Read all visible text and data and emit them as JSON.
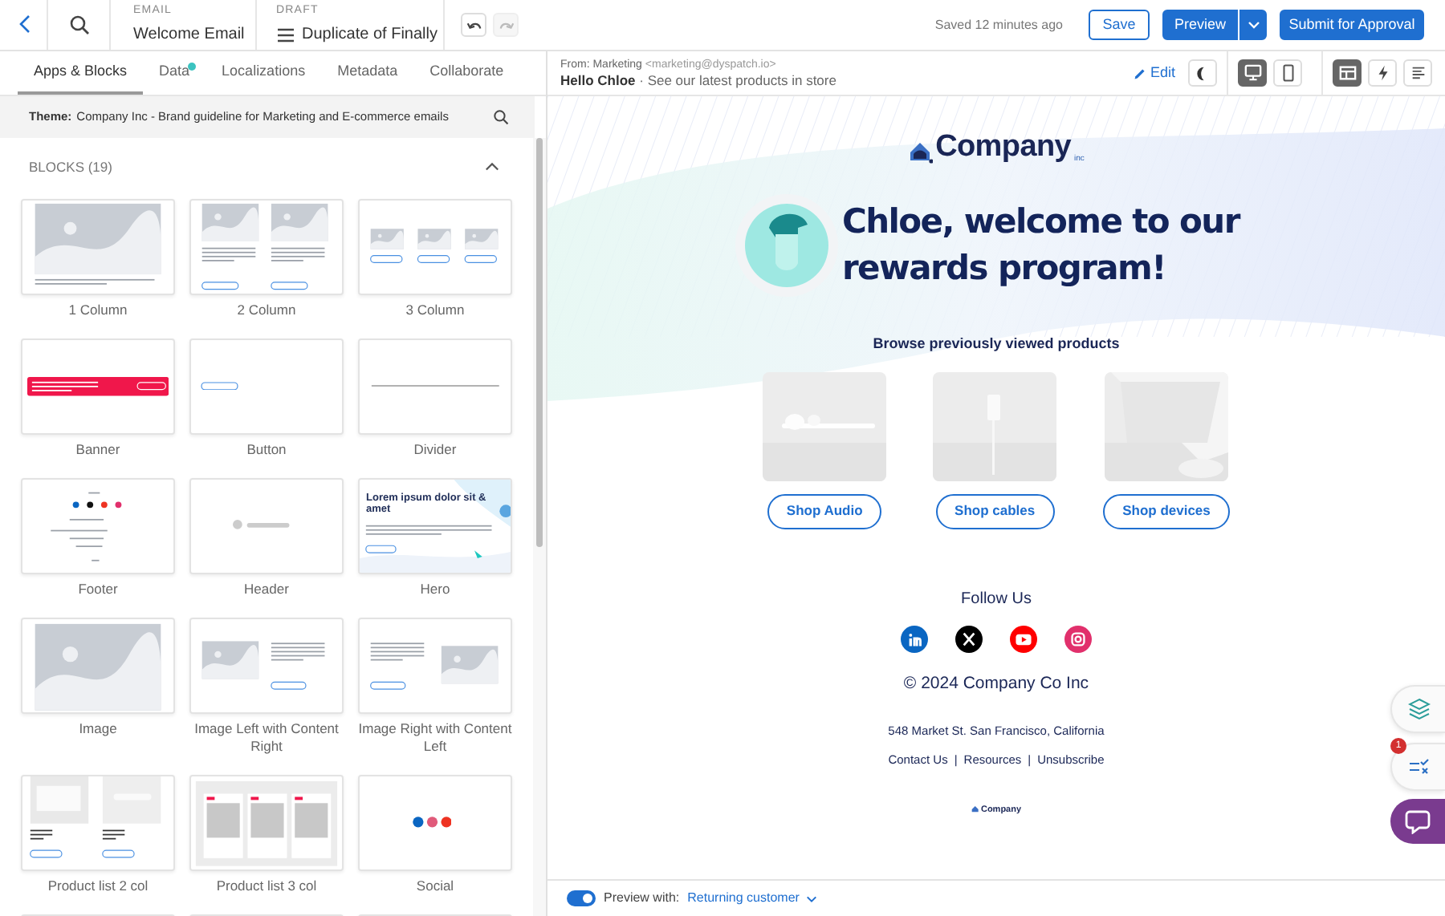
{
  "topbar": {
    "email_label": "EMAIL",
    "email_name": "Welcome Email",
    "draft_label": "DRAFT",
    "draft_name": "Duplicate of Finally",
    "undo_disabled": false,
    "redo_disabled": true,
    "saved": "Saved 12 minutes ago",
    "buttons": [
      {
        "label": "Save",
        "kind": "outline"
      },
      {
        "label": "Preview",
        "kind": "split"
      },
      {
        "label": "Submit for Approval",
        "kind": "primary"
      }
    ]
  },
  "tabs": [
    {
      "label": "Apps & Blocks",
      "selected": true,
      "notification": false
    },
    {
      "label": "Data",
      "selected": false,
      "notification": true
    },
    {
      "label": "Localizations",
      "selected": false,
      "notification": false
    },
    {
      "label": "Metadata",
      "selected": false,
      "notification": false
    },
    {
      "label": "Collaborate",
      "selected": false,
      "notification": false
    }
  ],
  "theme": {
    "label": "Theme:",
    "value": "Company Inc - Brand guideline for Marketing and E-commerce emails"
  },
  "blocks": {
    "title": "BLOCKS (19)",
    "expanded": true,
    "items": [
      {
        "label": "1 Column",
        "kind": "one-column"
      },
      {
        "label": "2 Column",
        "kind": "two-column"
      },
      {
        "label": "3 Column",
        "kind": "three-column"
      },
      {
        "label": "Banner",
        "kind": "banner"
      },
      {
        "label": "Button",
        "kind": "button"
      },
      {
        "label": "Divider",
        "kind": "divider"
      },
      {
        "label": "Footer",
        "kind": "footer"
      },
      {
        "label": "Header",
        "kind": "header"
      },
      {
        "label": "Hero",
        "kind": "hero",
        "heading": "Lorem ipsum dolor sit & amet"
      },
      {
        "label": "Image"
      },
      {
        "label": "Image Left with Content Right",
        "kind": "image-left"
      },
      {
        "label": "Image Right with Content Left",
        "kind": "image-right"
      },
      {
        "label": "Product list 2 col",
        "kind": "product-2"
      },
      {
        "label": "Product list 3 col",
        "kind": "product-3"
      },
      {
        "label": "Social",
        "kind": "social"
      },
      {
        "kind": "blank"
      },
      {
        "kind": "blank"
      },
      {
        "kind": "blank"
      }
    ]
  },
  "preview_header": {
    "from": "From: Marketing",
    "address": "<marketing@dyspatch.io>",
    "subject": "Hello Chloe",
    "preheader": "· See our latest products in store",
    "edit": "Edit",
    "dark_mode": false,
    "devices": [
      {
        "kind": "desktop",
        "selected": true
      },
      {
        "kind": "mobile",
        "selected": false
      }
    ],
    "views": [
      {
        "kind": "layout",
        "selected": true
      },
      {
        "kind": "bolt",
        "selected": false
      },
      {
        "kind": "text",
        "selected": false
      }
    ]
  },
  "email": {
    "logo": "Company",
    "logo_suffix": "inc",
    "headline": "Chloe, welcome to our rewards program!",
    "browse_title": "Browse previously viewed products",
    "products": [
      {
        "kind": "picture",
        "button": "Shop Audio"
      },
      {
        "kind": "picture",
        "button": "Shop cables"
      },
      {
        "kind": "picture",
        "button": "Shop devices"
      }
    ],
    "follow": "Follow Us",
    "socials": [
      {
        "kind": "linkedin",
        "color": "#0a66c2"
      },
      {
        "kind": "x",
        "color": "#000000"
      },
      {
        "kind": "youtube",
        "color": "#ff0000"
      },
      {
        "kind": "instagram",
        "color": "#e1306c"
      }
    ],
    "copyright": "© 2024 Company Co Inc",
    "address": "548 Market St. San Francisco, California",
    "links": [
      "Contact Us",
      "Resources",
      "Unsubscribe"
    ],
    "link_separator": "|",
    "footer_logo": "Company"
  },
  "preview_bar": {
    "toggle_on": true,
    "label": "Preview with:",
    "audience": "Returning customer"
  },
  "floating": {
    "checklist_badge": "1"
  }
}
